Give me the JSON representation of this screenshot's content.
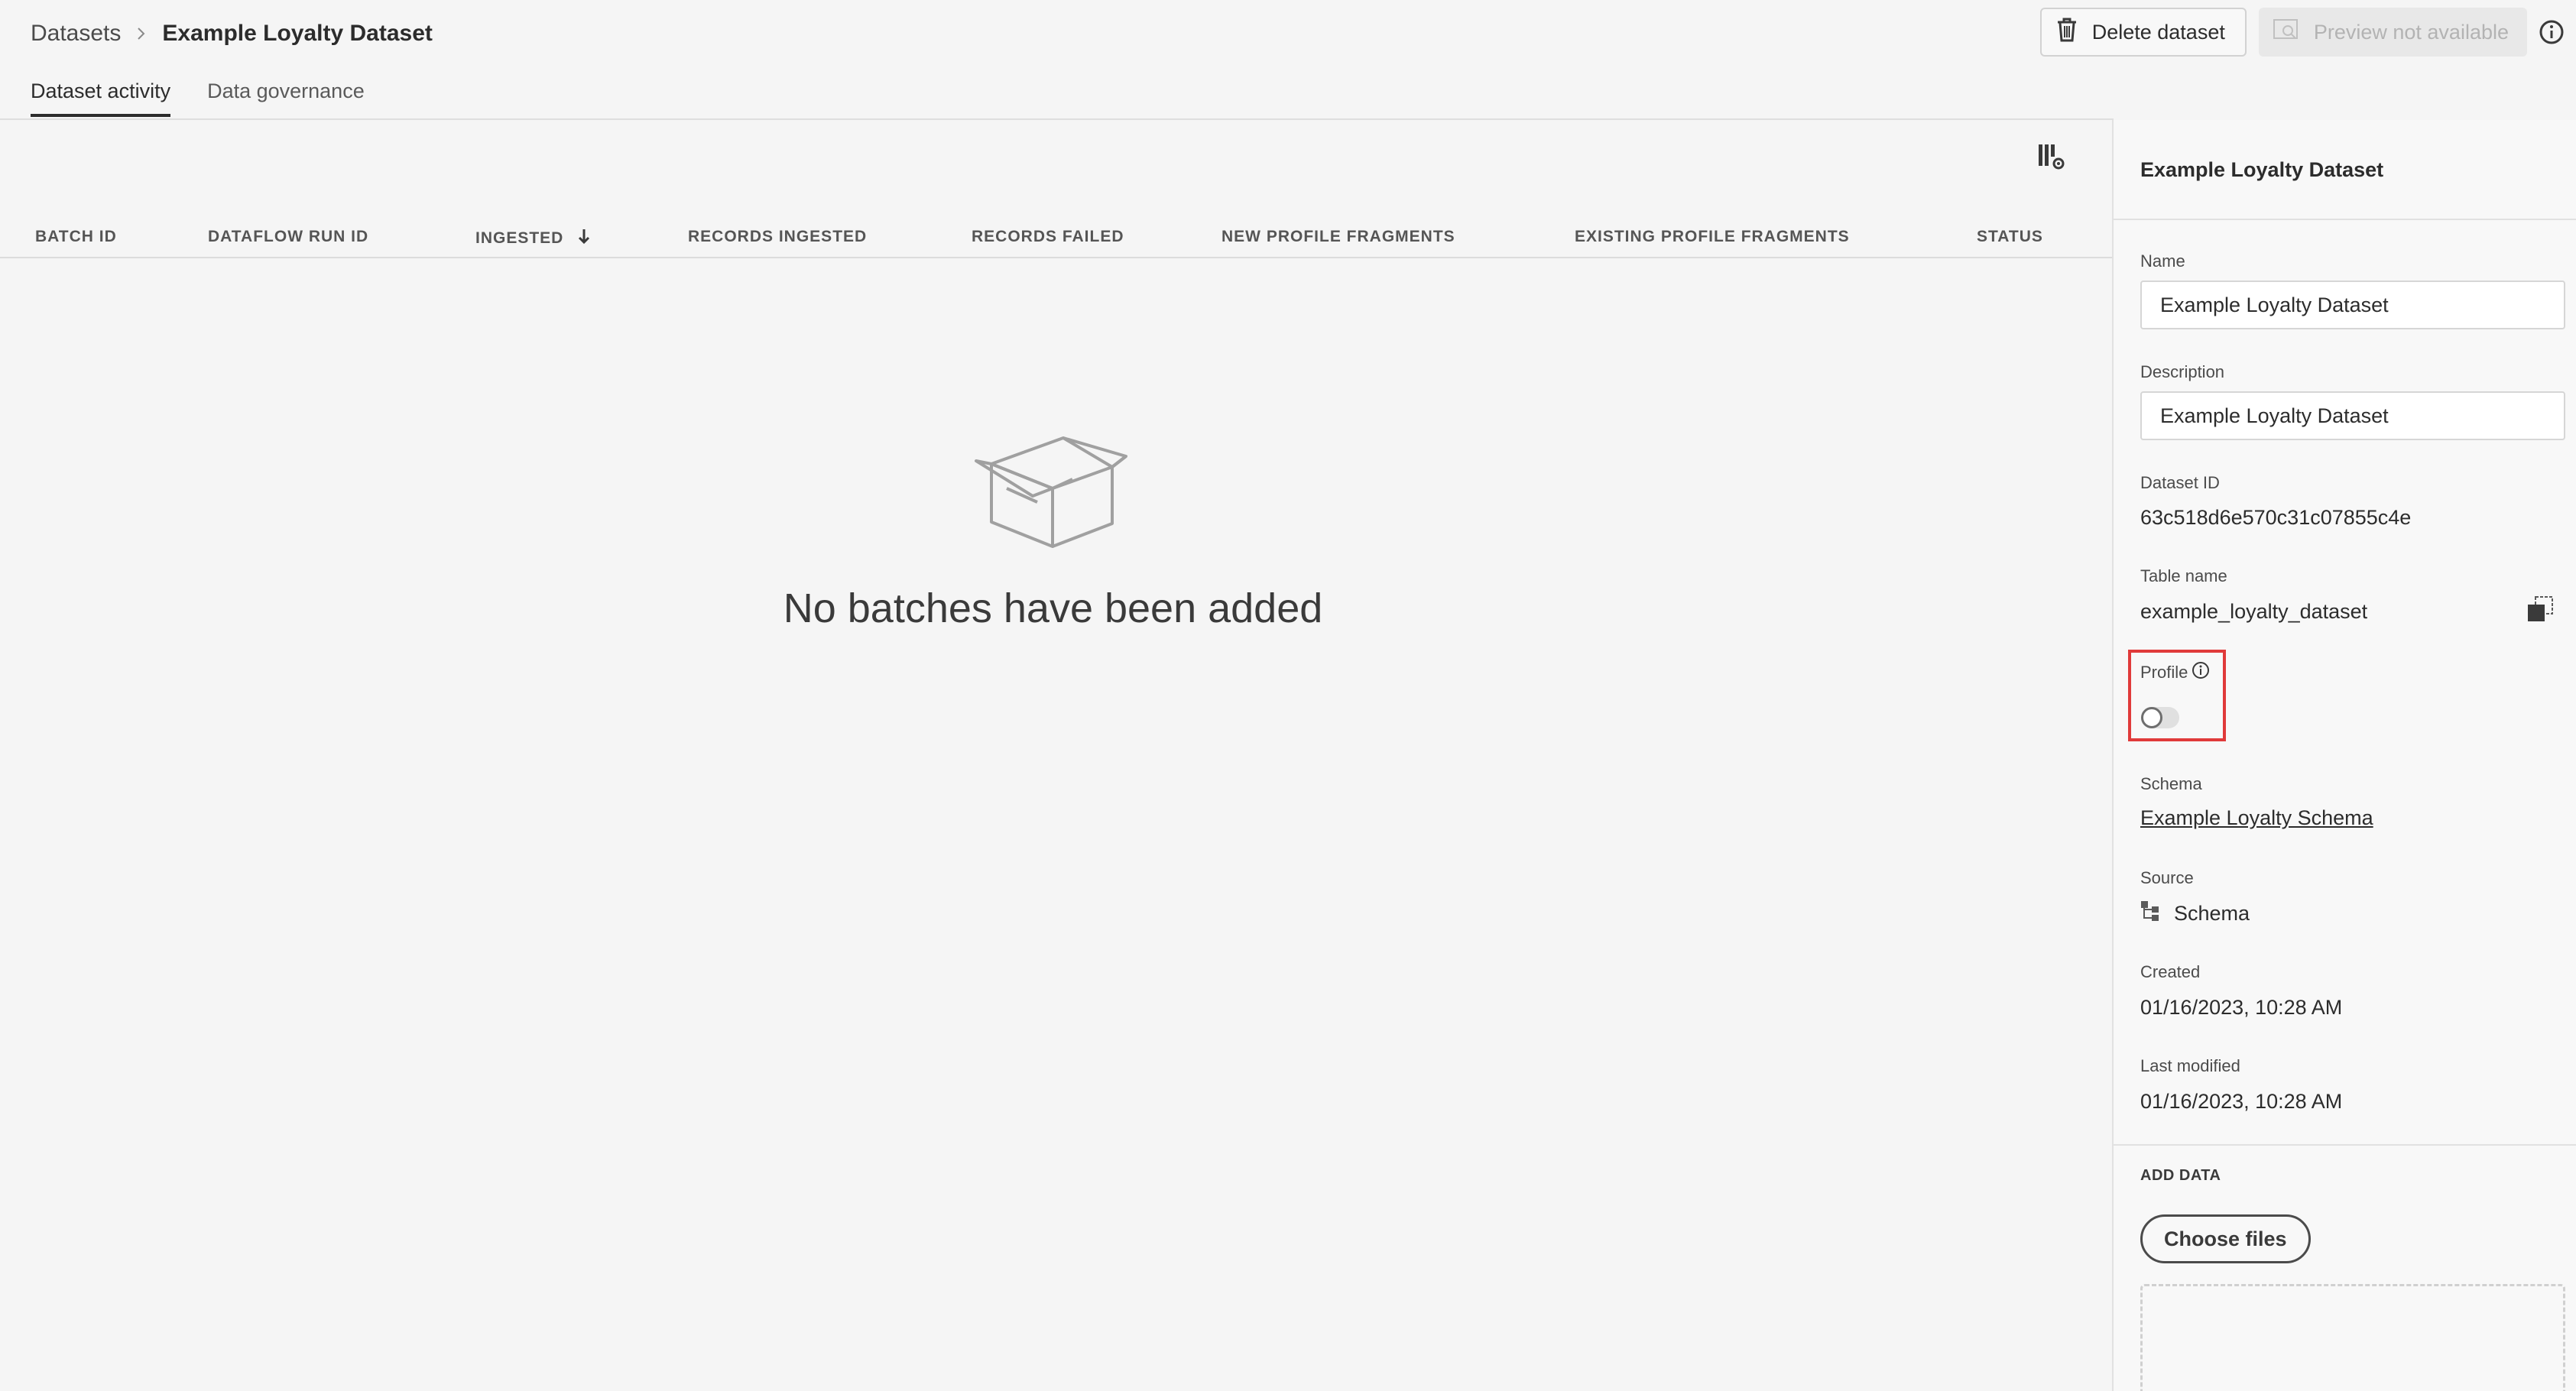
{
  "breadcrumb": {
    "parent": "Datasets",
    "current": "Example Loyalty Dataset"
  },
  "header": {
    "delete_label": "Delete dataset",
    "preview_label": "Preview not available",
    "icons": {
      "delete": "trash-icon",
      "preview": "preview-icon",
      "info": "info-icon"
    }
  },
  "tabs": [
    {
      "label": "Dataset activity",
      "active": true
    },
    {
      "label": "Data governance",
      "active": false
    }
  ],
  "table": {
    "columns": [
      "BATCH ID",
      "DATAFLOW RUN ID",
      "INGESTED",
      "RECORDS INGESTED",
      "RECORDS FAILED",
      "NEW PROFILE FRAGMENTS",
      "EXISTING PROFILE FRAGMENTS",
      "STATUS"
    ],
    "sorted_column": "INGESTED",
    "sort_direction": "descending",
    "rows": []
  },
  "empty_state": {
    "message": "No batches have been added",
    "icon": "empty-box-icon"
  },
  "panel": {
    "title": "Example Loyalty Dataset",
    "name_label": "Name",
    "name_value": "Example Loyalty Dataset",
    "description_label": "Description",
    "description_value": "Example Loyalty Dataset",
    "dataset_id_label": "Dataset ID",
    "dataset_id": "63c518d6e570c31c07855c4e",
    "table_name_label": "Table name",
    "table_name": "example_loyalty_dataset",
    "profile_label": "Profile",
    "profile_enabled": false,
    "schema_label": "Schema",
    "schema_link": "Example Loyalty Schema",
    "source_label": "Source",
    "source_value": "Schema",
    "created_label": "Created",
    "created_value": "01/16/2023, 10:28 AM",
    "modified_label": "Last modified",
    "modified_value": "01/16/2023, 10:28 AM",
    "add_data_label": "ADD DATA",
    "choose_files_label": "Choose files"
  },
  "colors": {
    "highlight": "#e03a3a",
    "background": "#f5f5f5",
    "panel": "#f8f8f8"
  }
}
